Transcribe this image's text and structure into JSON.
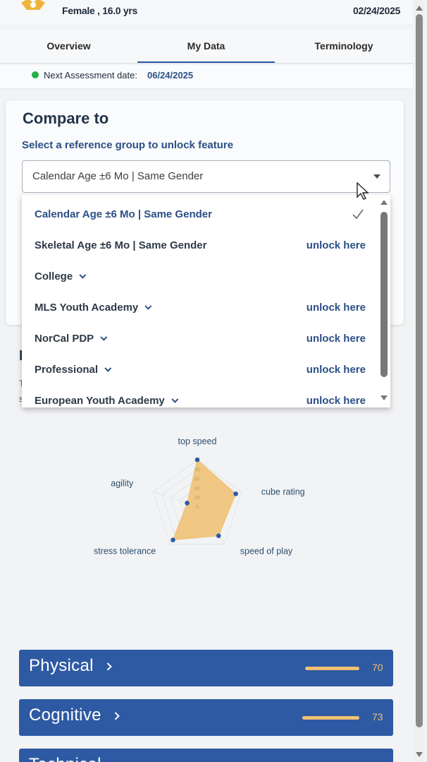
{
  "header": {
    "profile": "Female , 16.0 yrs",
    "date": "02/24/2025"
  },
  "tabs": [
    {
      "label": "Overview",
      "active": false
    },
    {
      "label": "My Data",
      "active": true
    },
    {
      "label": "Terminology",
      "active": false
    }
  ],
  "assessment": {
    "label": "Next Assessment date:",
    "date": "06/24/2025",
    "status_color": "#21b14b"
  },
  "compare": {
    "title": "Compare to",
    "subtitle": "Select a reference group to unlock feature",
    "selected_value": "Calendar Age ±6 Mo | Same Gender",
    "options": [
      {
        "label": "Calendar Age ±6 Mo | Same Gender",
        "selected": true,
        "action": ""
      },
      {
        "label": "Skeletal Age ±6 Mo | Same Gender",
        "selected": false,
        "action": "unlock here"
      },
      {
        "label": "College",
        "selected": false,
        "action": "",
        "expandable": true
      },
      {
        "label": "MLS Youth Academy",
        "selected": false,
        "action": "unlock here",
        "expandable": true
      },
      {
        "label": "NorCal PDP",
        "selected": false,
        "action": "unlock here",
        "expandable": true
      },
      {
        "label": "Professional",
        "selected": false,
        "action": "unlock here",
        "expandable": true
      },
      {
        "label": "European Youth Academy",
        "selected": false,
        "action": "unlock here",
        "expandable": true
      }
    ]
  },
  "radar": {
    "axes": [
      "top speed",
      "cube rating",
      "speed of play",
      "stress tolerance",
      "agility"
    ],
    "values": [
      100,
      87,
      78,
      89,
      23
    ],
    "scale": [
      0,
      100
    ],
    "ticks": [
      "0",
      "20",
      "40",
      "60",
      "80"
    ],
    "fill_color": "#f0c070",
    "point_color": "#2e5aa3"
  },
  "categories": [
    {
      "title": "Physical",
      "value": "70",
      "fraction": 0.7
    },
    {
      "title": "Cognitive",
      "value": "73",
      "fraction": 0.73
    },
    {
      "title": "Technical",
      "value": "",
      "fraction": 0
    }
  ],
  "colors": {
    "accent": "#2e5aa3",
    "link": "#2b4f86",
    "bar": "#f0c070"
  }
}
